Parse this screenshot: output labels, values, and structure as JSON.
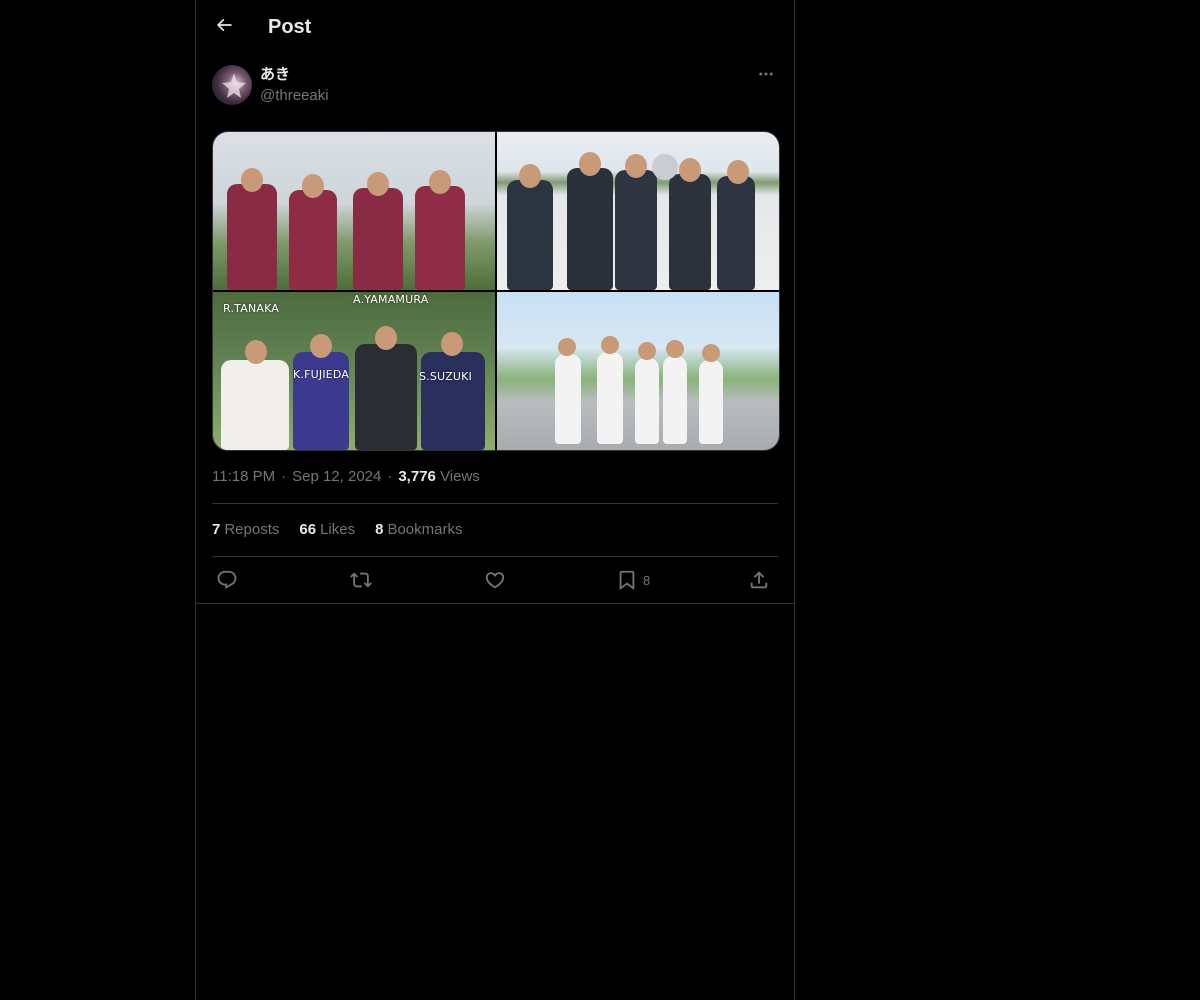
{
  "header": {
    "title": "Post",
    "back_icon": "arrow-left-icon"
  },
  "author": {
    "display_name": "あき",
    "handle": "@threeaki",
    "more_icon": "more-horizontal-icon"
  },
  "media": {
    "photos": [
      {
        "labels": []
      },
      {
        "labels": []
      },
      {
        "labels": [
          "R.TANAKA",
          "A.YAMAMURA",
          "K.FUJIEDA",
          "S.SUZUKI"
        ]
      },
      {
        "labels": []
      }
    ]
  },
  "meta": {
    "time": "11:18 PM",
    "separator": "·",
    "date": "Sep 12, 2024",
    "views_count": "3,776",
    "views_label": "Views"
  },
  "stats": {
    "reposts_count": "7",
    "reposts_label": "Reposts",
    "likes_count": "66",
    "likes_label": "Likes",
    "bookmarks_count": "8",
    "bookmarks_label": "Bookmarks"
  },
  "actions": {
    "reply_icon": "reply-icon",
    "repost_icon": "repost-icon",
    "like_icon": "heart-icon",
    "bookmark_icon": "bookmark-icon",
    "bookmark_count": "8",
    "share_icon": "share-icon"
  },
  "colors": {
    "background": "#000000",
    "border": "#2f3336",
    "text_primary": "#e7e9ea",
    "text_secondary": "#71767b"
  }
}
